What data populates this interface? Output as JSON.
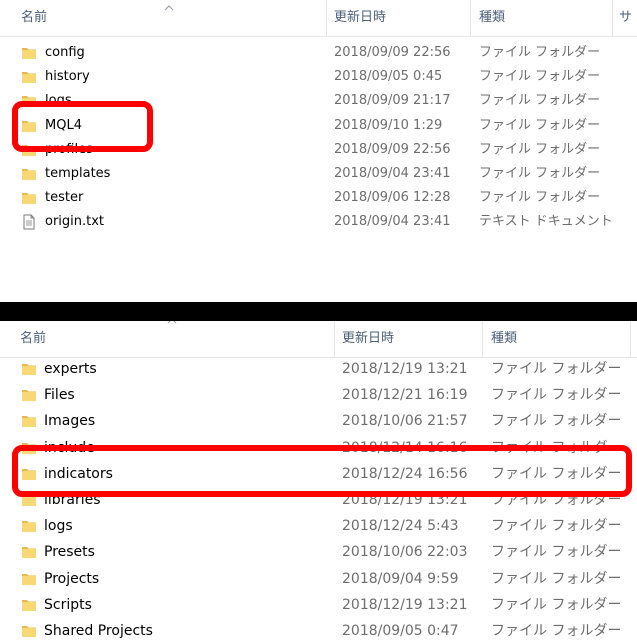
{
  "colors": {
    "highlight": "#ff0000",
    "folder": "#f8d775",
    "header_text": "#4c607a",
    "secondary_text": "#6d6d6d",
    "divider_bar": "#000000"
  },
  "top_pane": {
    "columns": [
      "名前",
      "更新日時",
      "種類",
      "サ"
    ],
    "rows": [
      {
        "icon": "folder-icon",
        "name": "config",
        "date": "2018/09/09 22:56",
        "type": "ファイル フォルダー"
      },
      {
        "icon": "folder-icon",
        "name": "history",
        "date": "2018/09/05 0:45",
        "type": "ファイル フォルダー"
      },
      {
        "icon": "folder-icon",
        "name": "logs",
        "date": "2018/09/09 21:17",
        "type": "ファイル フォルダー"
      },
      {
        "icon": "folder-icon",
        "name": "MQL4",
        "date": "2018/09/10 1:29",
        "type": "ファイル フォルダー"
      },
      {
        "icon": "folder-icon",
        "name": "profiles",
        "date": "2018/09/09 22:56",
        "type": "ファイル フォルダー"
      },
      {
        "icon": "folder-icon",
        "name": "templates",
        "date": "2018/09/04 23:41",
        "type": "ファイル フォルダー"
      },
      {
        "icon": "folder-icon",
        "name": "tester",
        "date": "2018/09/06 12:28",
        "type": "ファイル フォルダー"
      },
      {
        "icon": "text-file-icon",
        "name": "origin.txt",
        "date": "2018/09/04 23:41",
        "type": "テキスト ドキュメント"
      }
    ]
  },
  "bottom_pane": {
    "columns": [
      "名前",
      "更新日時",
      "種類"
    ],
    "rows": [
      {
        "icon": "folder-icon",
        "name": "experts",
        "date": "2018/12/19 13:21",
        "type": "ファイル フォルダー"
      },
      {
        "icon": "folder-icon",
        "name": "Files",
        "date": "2018/12/21 16:19",
        "type": "ファイル フォルダー"
      },
      {
        "icon": "folder-icon",
        "name": "Images",
        "date": "2018/10/06 21:57",
        "type": "ファイル フォルダー"
      },
      {
        "icon": "folder-icon",
        "name": "include",
        "date": "2018/12/14 16:16",
        "type": "ファイル フォルダー"
      },
      {
        "icon": "folder-icon",
        "name": "indicators",
        "date": "2018/12/24 16:56",
        "type": "ファイル フォルダー"
      },
      {
        "icon": "folder-icon",
        "name": "libraries",
        "date": "2018/12/19 13:21",
        "type": "ファイル フォルダー"
      },
      {
        "icon": "folder-icon",
        "name": "logs",
        "date": "2018/12/24 5:43",
        "type": "ファイル フォルダー"
      },
      {
        "icon": "folder-icon",
        "name": "Presets",
        "date": "2018/10/06 22:03",
        "type": "ファイル フォルダー"
      },
      {
        "icon": "folder-icon",
        "name": "Projects",
        "date": "2018/09/04 9:59",
        "type": "ファイル フォルダー"
      },
      {
        "icon": "folder-icon",
        "name": "Scripts",
        "date": "2018/12/19 13:21",
        "type": "ファイル フォルダー"
      },
      {
        "icon": "folder-icon",
        "name": "Shared Projects",
        "date": "2018/09/05 0:47",
        "type": "ファイル フォルダー"
      }
    ]
  }
}
